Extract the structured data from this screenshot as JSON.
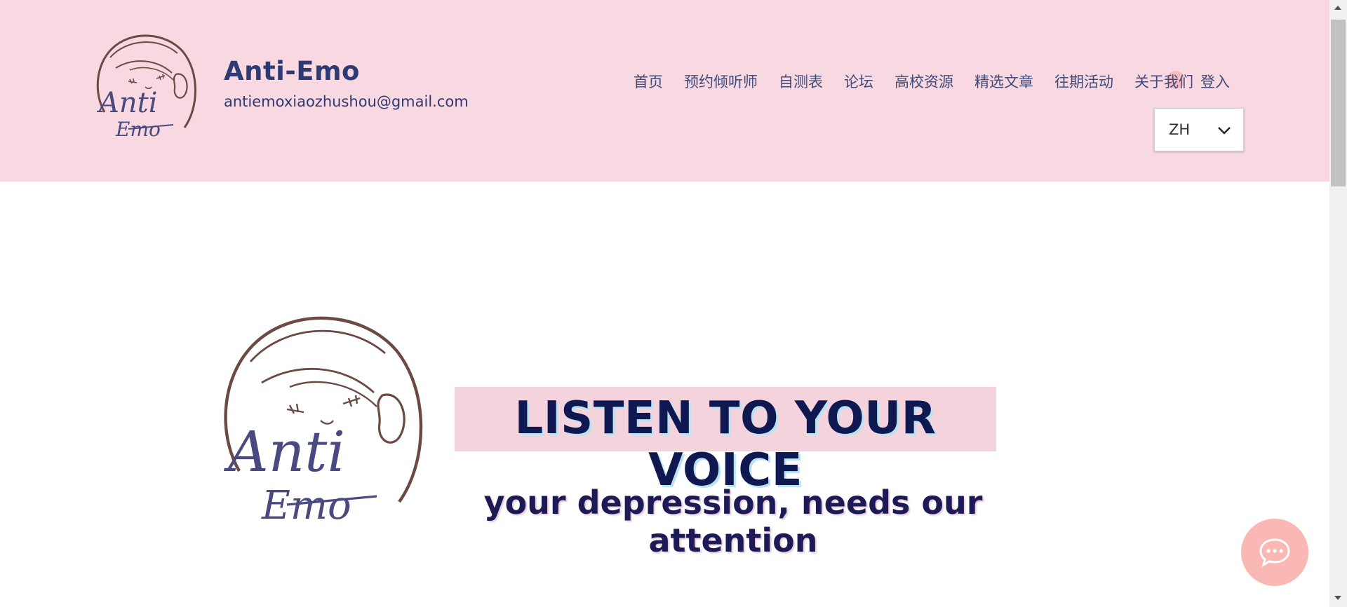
{
  "brand": {
    "name": "Anti-Emo",
    "email": "antiemoxiaozhushou@gmail.com"
  },
  "nav": {
    "items": [
      {
        "label": "首页"
      },
      {
        "label": "预约倾听师"
      },
      {
        "label": "自测表"
      },
      {
        "label": "论坛"
      },
      {
        "label": "高校资源"
      },
      {
        "label": "精选文章"
      },
      {
        "label": "往期活动"
      },
      {
        "label": "关于我们"
      }
    ],
    "login_label": "登入"
  },
  "language": {
    "selected": "ZH"
  },
  "logo": {
    "word1": "Anti",
    "word2": "Emo"
  },
  "hero": {
    "headline": "LISTEN TO YOUR VOICE",
    "subline": "your depression, needs our attention"
  },
  "icons": {
    "chat": "chat-bubble-icon",
    "chevron": "chevron-down-icon"
  },
  "colors": {
    "header_bg": "#f8d9e2",
    "brand_text": "#2e3a73",
    "chat_button": "#f9b8b3",
    "headline_bg": "#f5d3dc"
  }
}
